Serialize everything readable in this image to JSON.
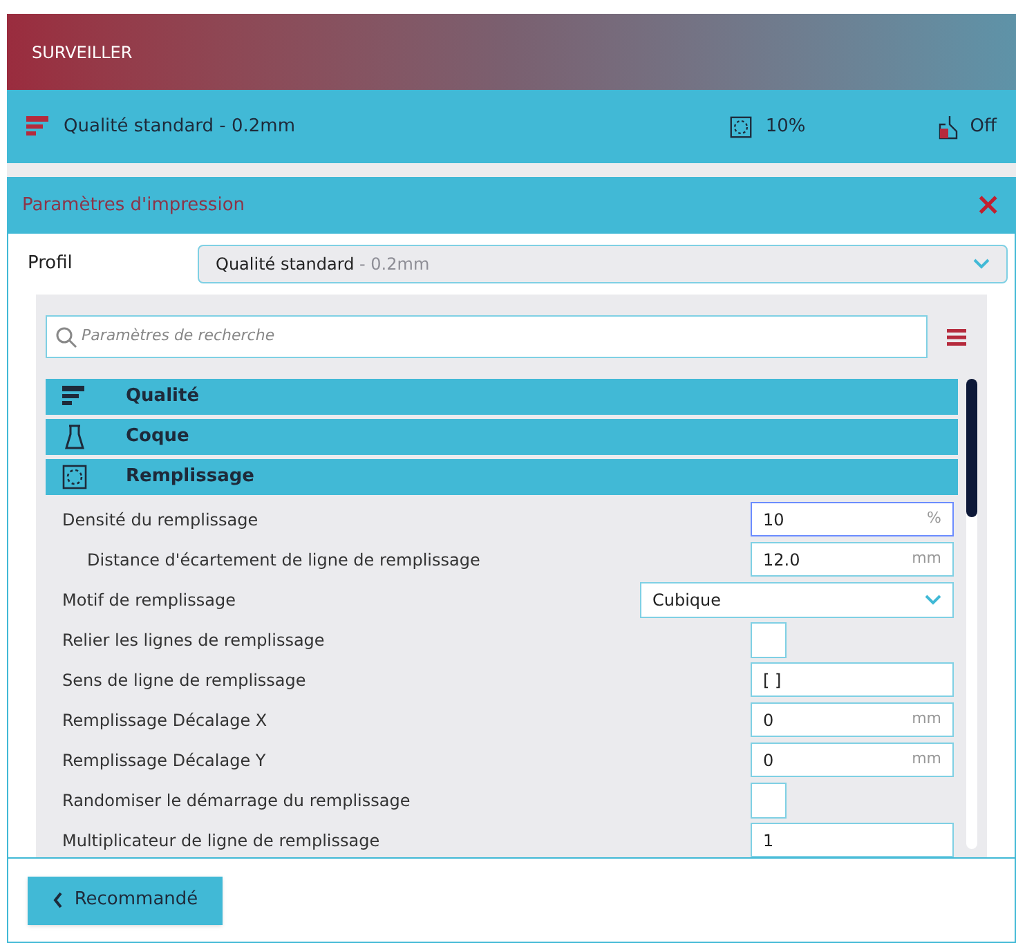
{
  "header": {
    "title": "SURVEILLER"
  },
  "summary_bar": {
    "profile": "Qualité standard - 0.2mm",
    "infill": "10%",
    "support": "Off"
  },
  "panel": {
    "title": "Paramètres d'impression",
    "close": "×",
    "profile": {
      "label": "Profil",
      "name": "Qualité standard",
      "detail": "- 0.2mm"
    },
    "search": {
      "placeholder": "Paramètres de recherche"
    },
    "categories": [
      {
        "label": "Qualité",
        "kind": "quality"
      },
      {
        "label": "Coque",
        "kind": "shell"
      },
      {
        "label": "Remplissage",
        "kind": "infill"
      }
    ],
    "settings": [
      {
        "label": "Densité du remplissage",
        "kind": "number",
        "value": "10",
        "unit": "%",
        "focused": true,
        "children": [
          {
            "label": "Distance d'écartement de ligne de remplissage",
            "kind": "number",
            "value": "12.0",
            "unit": "mm",
            "focused": false
          }
        ]
      },
      {
        "label": "Motif de remplissage",
        "kind": "select",
        "value": "Cubique"
      },
      {
        "label": "Relier les lignes de remplissage",
        "kind": "checkbox",
        "checked": false
      },
      {
        "label": "Sens de ligne de remplissage",
        "kind": "number",
        "value": "[ ]",
        "focused": false
      },
      {
        "label": "Remplissage Décalage X",
        "kind": "number",
        "value": "0",
        "unit": "mm",
        "focused": false
      },
      {
        "label": "Remplissage Décalage Y",
        "kind": "number",
        "value": "0",
        "unit": "mm",
        "focused": false
      },
      {
        "label": "Randomiser le démarrage du remplissage",
        "kind": "checkbox",
        "checked": false
      },
      {
        "label": "Multiplicateur de ligne de remplissage",
        "kind": "number",
        "value": "1",
        "focused": false
      }
    ]
  },
  "footer": {
    "button": "Recommandé"
  }
}
